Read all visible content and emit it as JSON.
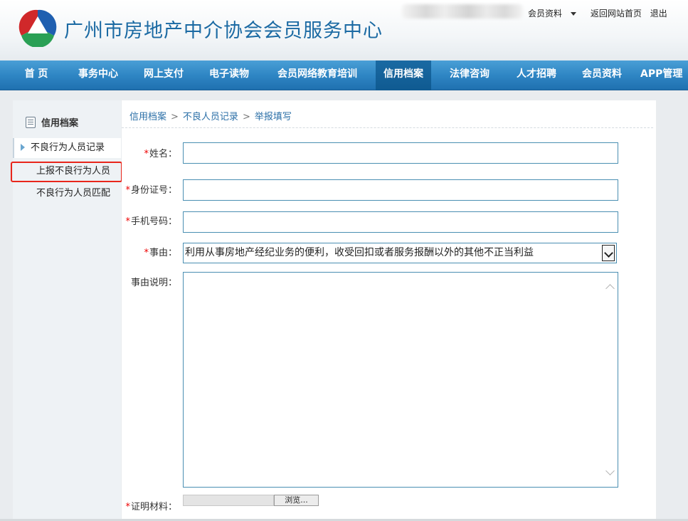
{
  "header": {
    "site_title": "广州市房地产中介协会会员服务中心",
    "member_info": "会员资料",
    "back_home": "返回网站首页",
    "logout": "退出"
  },
  "nav": {
    "items": [
      "首 页",
      "事务中心",
      "网上支付",
      "电子读物",
      "会员网络教育培训",
      "信用档案",
      "法律咨询",
      "人才招聘",
      "会员资料",
      "APP管理"
    ],
    "active": "信用档案"
  },
  "sidebar": {
    "title": "信用档案",
    "items": [
      "不良行为人员记录",
      "上报不良行为人员",
      "不良行为人员匹配"
    ]
  },
  "breadcrumb": [
    "信用档案",
    "不良人员记录",
    "举报填写"
  ],
  "form": {
    "required_mark": "*",
    "name_label": "姓名：",
    "id_label": "身份证号：",
    "phone_label": "手机号码：",
    "reason_label": "事由：",
    "reason_value": "利用从事房地产经纪业务的便利，收受回扣或者服务报酬以外的其他不正当利益",
    "desc_label": "事由说明：",
    "proof_label": "证明材料：",
    "browse_button": "浏览..."
  },
  "colors": {
    "nav_blue": "#2f86c4",
    "title_blue": "#1b6aa3",
    "highlight_red": "#e8261b"
  }
}
